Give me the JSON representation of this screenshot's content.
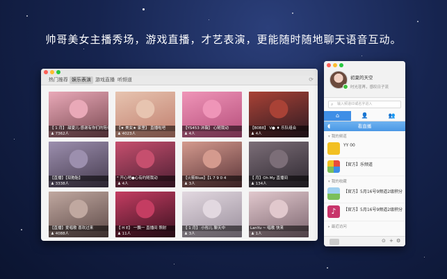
{
  "headline": "帅哥美女主播秀场，游戏直播，才艺表演，更能随时随地聊天语音互动。",
  "main_window": {
    "tabs": [
      {
        "label": "热门推荐",
        "active": false
      },
      {
        "label": "娱乐表演",
        "active": true
      },
      {
        "label": "游戏直播",
        "active": false
      },
      {
        "label": "听频道",
        "active": false
      }
    ],
    "refresh_icon": "refresh-icon",
    "tiles": [
      {
        "caption": "【 1 月】 甜夏儿·感谢有你们的陪伴",
        "count": "♟ 7362人",
        "colors": [
          "#e9a9b8",
          "#7b4a52"
        ]
      },
      {
        "caption": "【★ 美女★ 家里】 直播啦吧",
        "count": "♟ 4023人",
        "colors": [
          "#e7c4b0",
          "#c07e6e"
        ]
      },
      {
        "caption": "【YS453 沐薇】 心随我动",
        "count": "♟ 4人",
        "colors": [
          "#ef95b8",
          "#b54d7a"
        ]
      },
      {
        "caption": "【B0B8】 V● ♦ 乐队组合",
        "count": "♟ 4人",
        "colors": [
          "#a94236",
          "#2d1a22"
        ]
      },
      {
        "caption": "【直播】【双胞胎】",
        "count": "♟ 3338人",
        "colors": [
          "#9c8fae",
          "#463b4f"
        ]
      },
      {
        "caption": "° 开心吧●心有约随我动",
        "count": "♟ 4人",
        "colors": [
          "#c64f6e",
          "#4d1f33"
        ]
      },
      {
        "caption": "【火箭Blue】【1 7 9 0 4",
        "count": "♟ 3人",
        "colors": [
          "#d49a8e",
          "#5b3438"
        ]
      },
      {
        "caption": "【 月】Oh My 直播间",
        "count": "♟ 134人",
        "colors": [
          "#7c6e78",
          "#2e2830"
        ]
      },
      {
        "caption": "【直播】爱唱歌 喜欢过来",
        "count": "♟ 4088人",
        "colors": [
          "#c0a8a0",
          "#5e4a48"
        ]
      },
      {
        "caption": "【 H E】 一飘一 直播间 照射",
        "count": "♟ 11人",
        "colors": [
          "#c43d62",
          "#3b1120"
        ]
      },
      {
        "caption": "【 1 月】 小彤儿 聊天中",
        "count": "♟ 3人",
        "colors": [
          "#e2d8e0",
          "#9a8f9c"
        ]
      },
      {
        "caption": "LanYu ~ 唱歌 快来",
        "count": "♟ 1人",
        "colors": [
          "#e1c8cd",
          "#7d6670"
        ]
      }
    ]
  },
  "side_panel": {
    "username": "初夏的天空",
    "signature": "时光荏苒，感叹日子流",
    "search_placeholder": "输入频道ID或名字进入",
    "tabs": [
      {
        "icon": "home-icon",
        "glyph": "⌂",
        "active": true
      },
      {
        "icon": "person-icon",
        "glyph": "👤",
        "active": false
      },
      {
        "icon": "group-icon",
        "glyph": "👥",
        "active": false
      }
    ],
    "banner_label": "看直播",
    "sections": [
      {
        "title": "我的频道",
        "items": [
          {
            "title": "YY 00",
            "sub1": "",
            "sub2": "",
            "color": "#f2c022",
            "icon": "bulb-icon"
          }
        ]
      },
      {
        "title": "",
        "items": [
          {
            "title": "【官方】乐频道",
            "sub1": "",
            "sub2": "",
            "color": "#e84c3d",
            "icon": "app-grid-icon"
          }
        ]
      },
      {
        "title": "我的收藏",
        "items": [
          {
            "title": "【官方】5月16号9频道2级积分",
            "sub1": "",
            "sub2": "",
            "color": "#7bbf5a",
            "icon": "landscape-icon"
          },
          {
            "title": "【官方】5月16号9频道2级积分",
            "sub1": "",
            "sub2": "",
            "color": "#c8346a",
            "icon": "music-icon"
          }
        ]
      }
    ],
    "recent_label": "最近访问",
    "bottom_icons": [
      "more-icon",
      "add-icon",
      "settings-icon"
    ]
  }
}
